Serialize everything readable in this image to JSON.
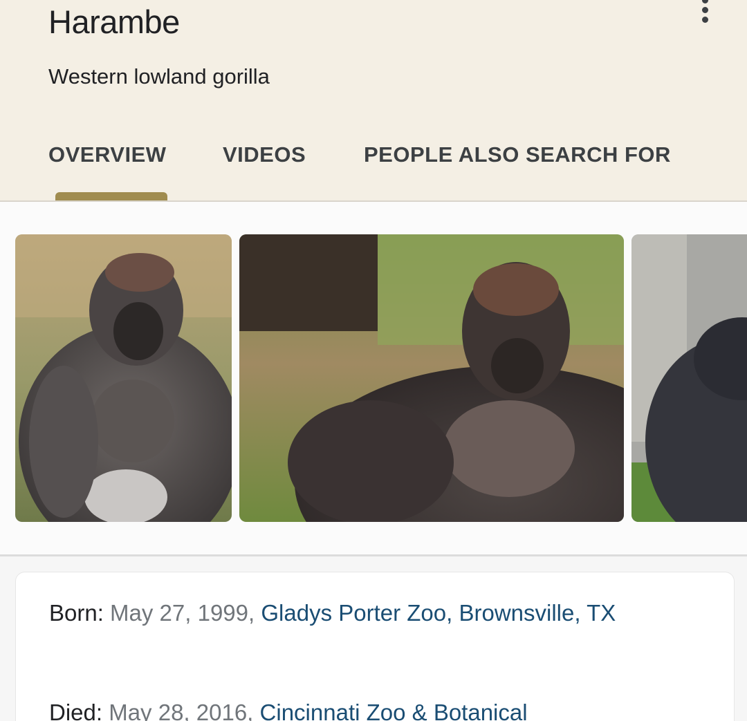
{
  "entity": {
    "title": "Harambe",
    "subtitle": "Western lowland gorilla"
  },
  "header": {
    "more_icon": "more-vert-icon"
  },
  "tabs": [
    {
      "label": "OVERVIEW",
      "active": true
    },
    {
      "label": "VIDEOS",
      "active": false
    },
    {
      "label": "PEOPLE ALSO SEARCH FOR",
      "active": false
    }
  ],
  "images": [
    {
      "name": "gorilla-photo-1"
    },
    {
      "name": "gorilla-photo-2"
    },
    {
      "name": "gorilla-photo-3"
    }
  ],
  "facts": {
    "born": {
      "label": "Born:",
      "date": " May 27, 1999, ",
      "link": "Gladys Porter Zoo, Brownsville, TX"
    },
    "died": {
      "label": "Died:",
      "date": " May 28, 2016, ",
      "link": "Cincinnati Zoo & Botanical"
    }
  },
  "colors": {
    "header_bg": "#f4efe4",
    "tab_indicator": "#a08c4f",
    "link": "#1a4d73"
  }
}
